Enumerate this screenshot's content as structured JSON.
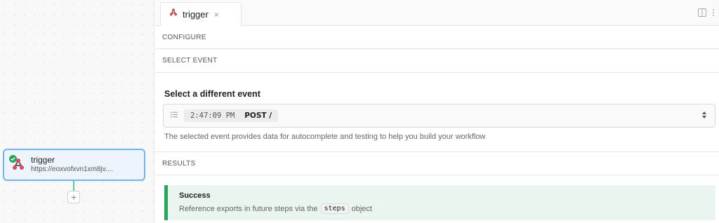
{
  "workflow": {
    "node": {
      "title": "trigger",
      "url": "https://eoxvofxvn1xm8jv....",
      "status": "success"
    },
    "add_step_label": "+"
  },
  "tabs": [
    {
      "label": "trigger",
      "close": "×"
    }
  ],
  "sections": {
    "configure": "CONFIGURE",
    "select_event": "SELECT EVENT",
    "results": "RESULTS"
  },
  "select_event": {
    "heading": "Select a different event",
    "selected": {
      "time": "2:47:09 PM",
      "method": "POST /"
    },
    "help": "The selected event provides data for autocomplete and testing to help you build your workflow"
  },
  "results": {
    "title": "Success",
    "message_before": "Reference exports in future steps via the",
    "code": "steps",
    "message_after": "object"
  },
  "colors": {
    "success": "#2aa55b",
    "success_bg": "#e9f5ee",
    "node_border": "#6cb6e8",
    "connector": "#5bc6a6"
  }
}
